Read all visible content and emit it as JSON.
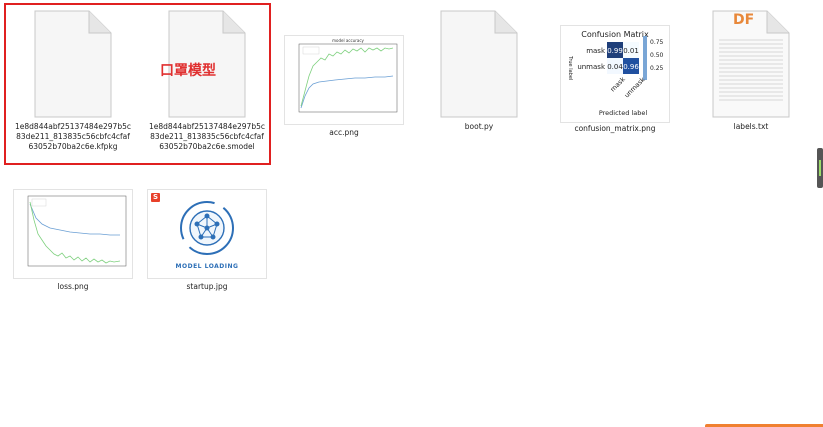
{
  "files": [
    {
      "name": "1e8d844abf25137484e297b5c83de211_813835c56cbfc4cfaf63052b70ba2c6e.kfpkg",
      "icon": "generic-file-icon"
    },
    {
      "name": "1e8d844abf25137484e297b5c83de211_813835c56cbfc4cfaf63052b70ba2c6e.smodel",
      "icon": "generic-file-icon"
    },
    {
      "name": "acc.png",
      "icon": "accuracy-chart-thumbnail"
    },
    {
      "name": "boot.py",
      "icon": "generic-file-icon"
    },
    {
      "name": "confusion_matrix.png",
      "icon": "confusion-matrix-thumbnail"
    },
    {
      "name": "labels.txt",
      "icon": "text-file-icon"
    },
    {
      "name": "loss.png",
      "icon": "loss-chart-thumbnail"
    },
    {
      "name": "startup.jpg",
      "icon": "model-loading-thumbnail"
    }
  ],
  "annotation": "口罩模型",
  "confusion": {
    "title": "Confusion Matrix",
    "rows": [
      "mask",
      "unmask"
    ],
    "cols": [
      "mask",
      "unmask"
    ],
    "values": [
      [
        "0.99",
        "0.01"
      ],
      [
        "0.04",
        "0.96"
      ]
    ],
    "xlabel": "Predicted label",
    "ylabel": "True label",
    "scale": [
      "0.75",
      "0.50",
      "0.25"
    ]
  },
  "startup": {
    "caption": "MODEL LOADING",
    "badge": "S"
  },
  "labels_txt": {
    "badge": "DF"
  },
  "colors": {
    "selection": "#e02020",
    "annotation": "#e03030",
    "accent": "#f08030"
  }
}
